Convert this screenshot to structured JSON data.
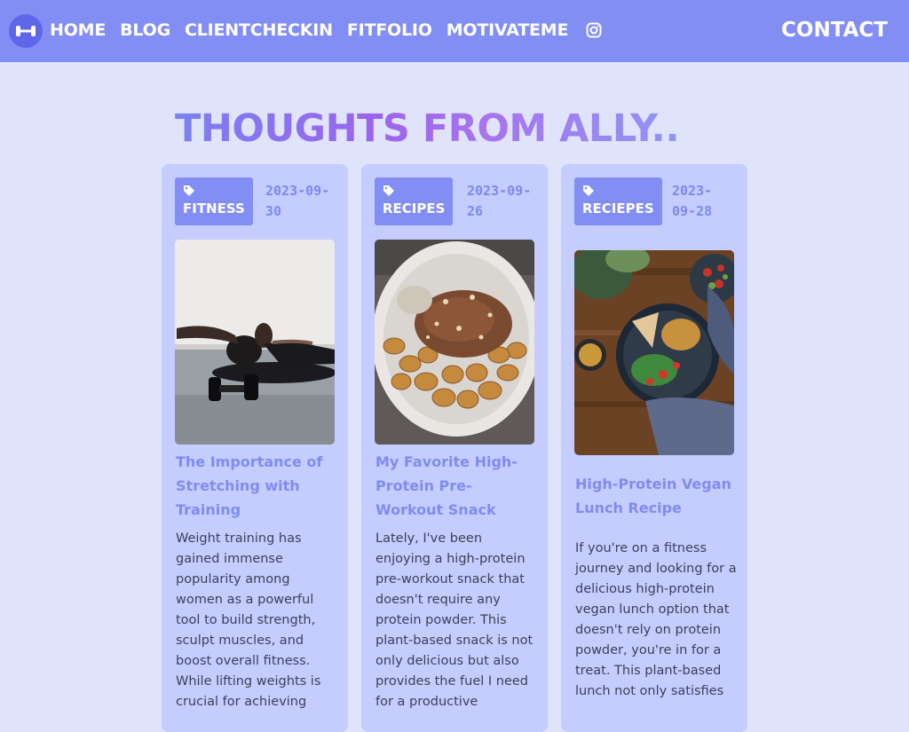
{
  "nav": {
    "logo_icon": "dumbbell-icon",
    "links": [
      "HOME",
      "BLOG",
      "CLIENTCHECKIN",
      "FITFOLIO",
      "MOTIVATEME"
    ],
    "instagram_icon": "instagram-icon",
    "contact": "CONTACT"
  },
  "page": {
    "title": "THOUGHTS FROM ALLY.."
  },
  "posts": [
    {
      "tag": "FITNESS",
      "tag_icon": "tag-icon",
      "date": "2023-09-30",
      "image": "woman stretching on floor next to dumbbells",
      "title": "The Importance of Stretching with Training",
      "excerpt": "Weight training has gained immense popularity among women as a powerful tool to build strength, sculpt muscles, and boost overall fitness. While lifting weights is crucial for achieving"
    },
    {
      "tag": "RECIPES",
      "tag_icon": "tag-icon",
      "date": "2023-09-26",
      "image": "bowl of banana slices topped with cocoa and nuts",
      "title": "My Favorite High-Protein Pre-Workout Snack",
      "excerpt": "Lately, I've been enjoying a high-protein pre-workout snack that doesn't require any protein powder. This plant-based snack is not only delicious but also provides the fuel I need for a productive"
    },
    {
      "tag": "RECIEPES",
      "tag_icon": "tag-icon",
      "date": "2023-09-28",
      "image": "vegan bowl with chickpeas, greens and tomatoes on wooden table",
      "title": "High-Protein Vegan Lunch Recipe",
      "excerpt": "If you're on a fitness journey and looking for a delicious high-protein vegan lunch option that doesn't rely on protein powder, you're in for a treat. This plant-based lunch not only satisfies"
    }
  ],
  "colors": {
    "navbar": "#838ef4",
    "page_bg": "#dfe4fb",
    "card_bg": "#c4cdfd",
    "accent": "#818bf0",
    "text": "#3d3f5a"
  }
}
